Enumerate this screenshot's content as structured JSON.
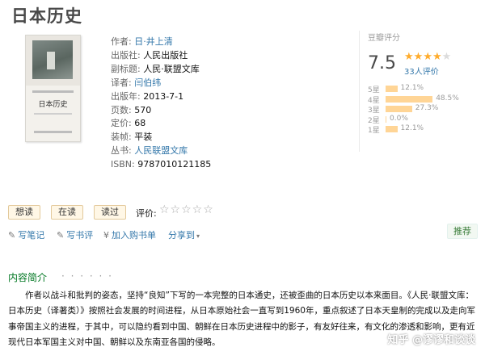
{
  "page_title": "日本历史",
  "cover": {
    "title": "日本历史"
  },
  "info": [
    {
      "label": "作者:",
      "value": "日·井上清",
      "link": true
    },
    {
      "label": "出版社:",
      "value": "人民出版社",
      "link": false
    },
    {
      "label": "副标题:",
      "value": "人民·联盟文库",
      "link": false
    },
    {
      "label": "译者:",
      "value": "闫伯纬",
      "link": true
    },
    {
      "label": "出版年:",
      "value": "2013-7-1",
      "link": false
    },
    {
      "label": "页数:",
      "value": "570",
      "link": false
    },
    {
      "label": "定价:",
      "value": "68",
      "link": false
    },
    {
      "label": "装帧:",
      "value": "平装",
      "link": false
    },
    {
      "label": "丛书:",
      "value": "人民联盟文库",
      "link": true
    },
    {
      "label": "ISBN:",
      "value": "9787010121185",
      "link": false
    }
  ],
  "rating": {
    "label": "豆瓣评分",
    "score": "7.5",
    "stars": 4,
    "count": "33人评价",
    "distribution": [
      {
        "label": "5星",
        "pct": "12.1%",
        "value": 12.1
      },
      {
        "label": "4星",
        "pct": "48.5%",
        "value": 48.5
      },
      {
        "label": "3星",
        "pct": "27.3%",
        "value": 27.3
      },
      {
        "label": "2星",
        "pct": "0.0%",
        "value": 0.0
      },
      {
        "label": "1星",
        "pct": "12.1%",
        "value": 12.1
      }
    ]
  },
  "actions": {
    "want": "想读",
    "reading": "在读",
    "read": "读过",
    "rate_label": "评价:"
  },
  "tools": {
    "note": "写笔记",
    "review": "写书评",
    "cart": "加入购书单",
    "share": "分享到"
  },
  "recommend": "推荐",
  "intro": {
    "title": "内容简介",
    "dots": "· · · · · ·",
    "text": "作者以战斗和批判的姿态，坚持“良知”下写的一本完整的日本通史，还被歪曲的日本历史以本来面目。《人民·联盟文库：日本历史（译著类）》按照社会发展的时间进程，从日本原始社会一直写到1960年，重点叙述了日本天皇制的完成以及走向军事帝国主义的进程，于其中，可以隐约看到中国、朝鲜在日本历史进程中的影子，有友好往来，有文化的渗透和影响，更有近现代日本军国主义对中国、朝鲜以及东南亚各国的侵略。"
  },
  "watermark": "知乎 @谬谬和谈谈"
}
